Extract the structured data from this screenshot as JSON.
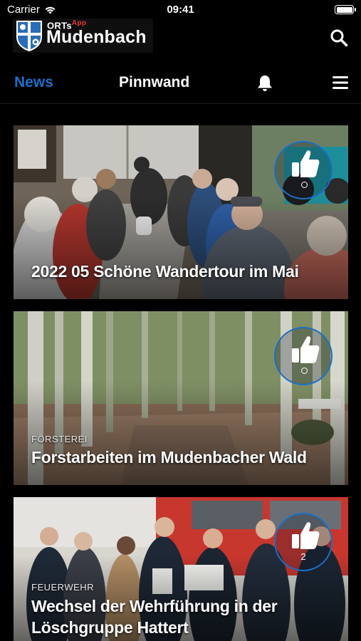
{
  "status_bar": {
    "carrier": "Carrier",
    "time": "09:41"
  },
  "header": {
    "logo_top": "ORTs",
    "logo_app": "App",
    "logo_name": "Mudenbach"
  },
  "nav": {
    "tabs": [
      {
        "label": "News",
        "active": true
      },
      {
        "label": "Pinnwand",
        "active": false
      }
    ]
  },
  "icons": {
    "search": "search-icon",
    "notifications": "bell-icon",
    "menu": "hamburger-menu-icon",
    "like": "thumbs-up-icon"
  },
  "colors": {
    "accent": "#1a6fc9",
    "background": "#000000",
    "like_ring": "#1b6fc8"
  },
  "news": [
    {
      "category": "",
      "title": "2022 05 Schöne Wandertour im Mai",
      "likes": ""
    },
    {
      "category": "FÖRSTEREI",
      "title": "Forstarbeiten im Mudenbacher Wald",
      "likes": ""
    },
    {
      "category": "FEUERWEHR",
      "title": "Wechsel der Wehrführung in der Löschgruppe Hattert",
      "likes": "2"
    }
  ]
}
